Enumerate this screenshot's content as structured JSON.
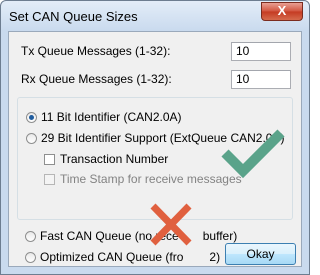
{
  "window": {
    "title": "Set CAN Queue Sizes",
    "close_glyph": "X"
  },
  "tx": {
    "label": "Tx Queue Messages (1-32):",
    "value": "10"
  },
  "rx": {
    "label": "Rx Queue Messages (1-32):",
    "value": "10"
  },
  "identifier": {
    "options": [
      {
        "label": "11 Bit Identifier (CAN2.0A)",
        "selected": true
      },
      {
        "label": "29 Bit Identifier Support (ExtQueue CAN2.0B)",
        "selected": false
      }
    ],
    "transaction_number": {
      "label": "Transaction Number",
      "checked": false
    },
    "time_stamp": {
      "label": "Time Stamp for receive messages",
      "checked": false,
      "enabled": false
    }
  },
  "queue_mode": {
    "options": [
      {
        "label": "Fast CAN Queue (no rece",
        "selected": false,
        "label_end": "buffer)"
      },
      {
        "label": "Optimized CAN Queue (fro",
        "selected": false,
        "label_end": "2)"
      }
    ]
  },
  "buttons": {
    "okay": "Okay"
  },
  "annotations": {
    "checkmark_color": "#5aa38a",
    "cross_color": "#e0603f",
    "checkmark_icon": "checkmark-icon",
    "cross_icon": "cross-icon"
  }
}
